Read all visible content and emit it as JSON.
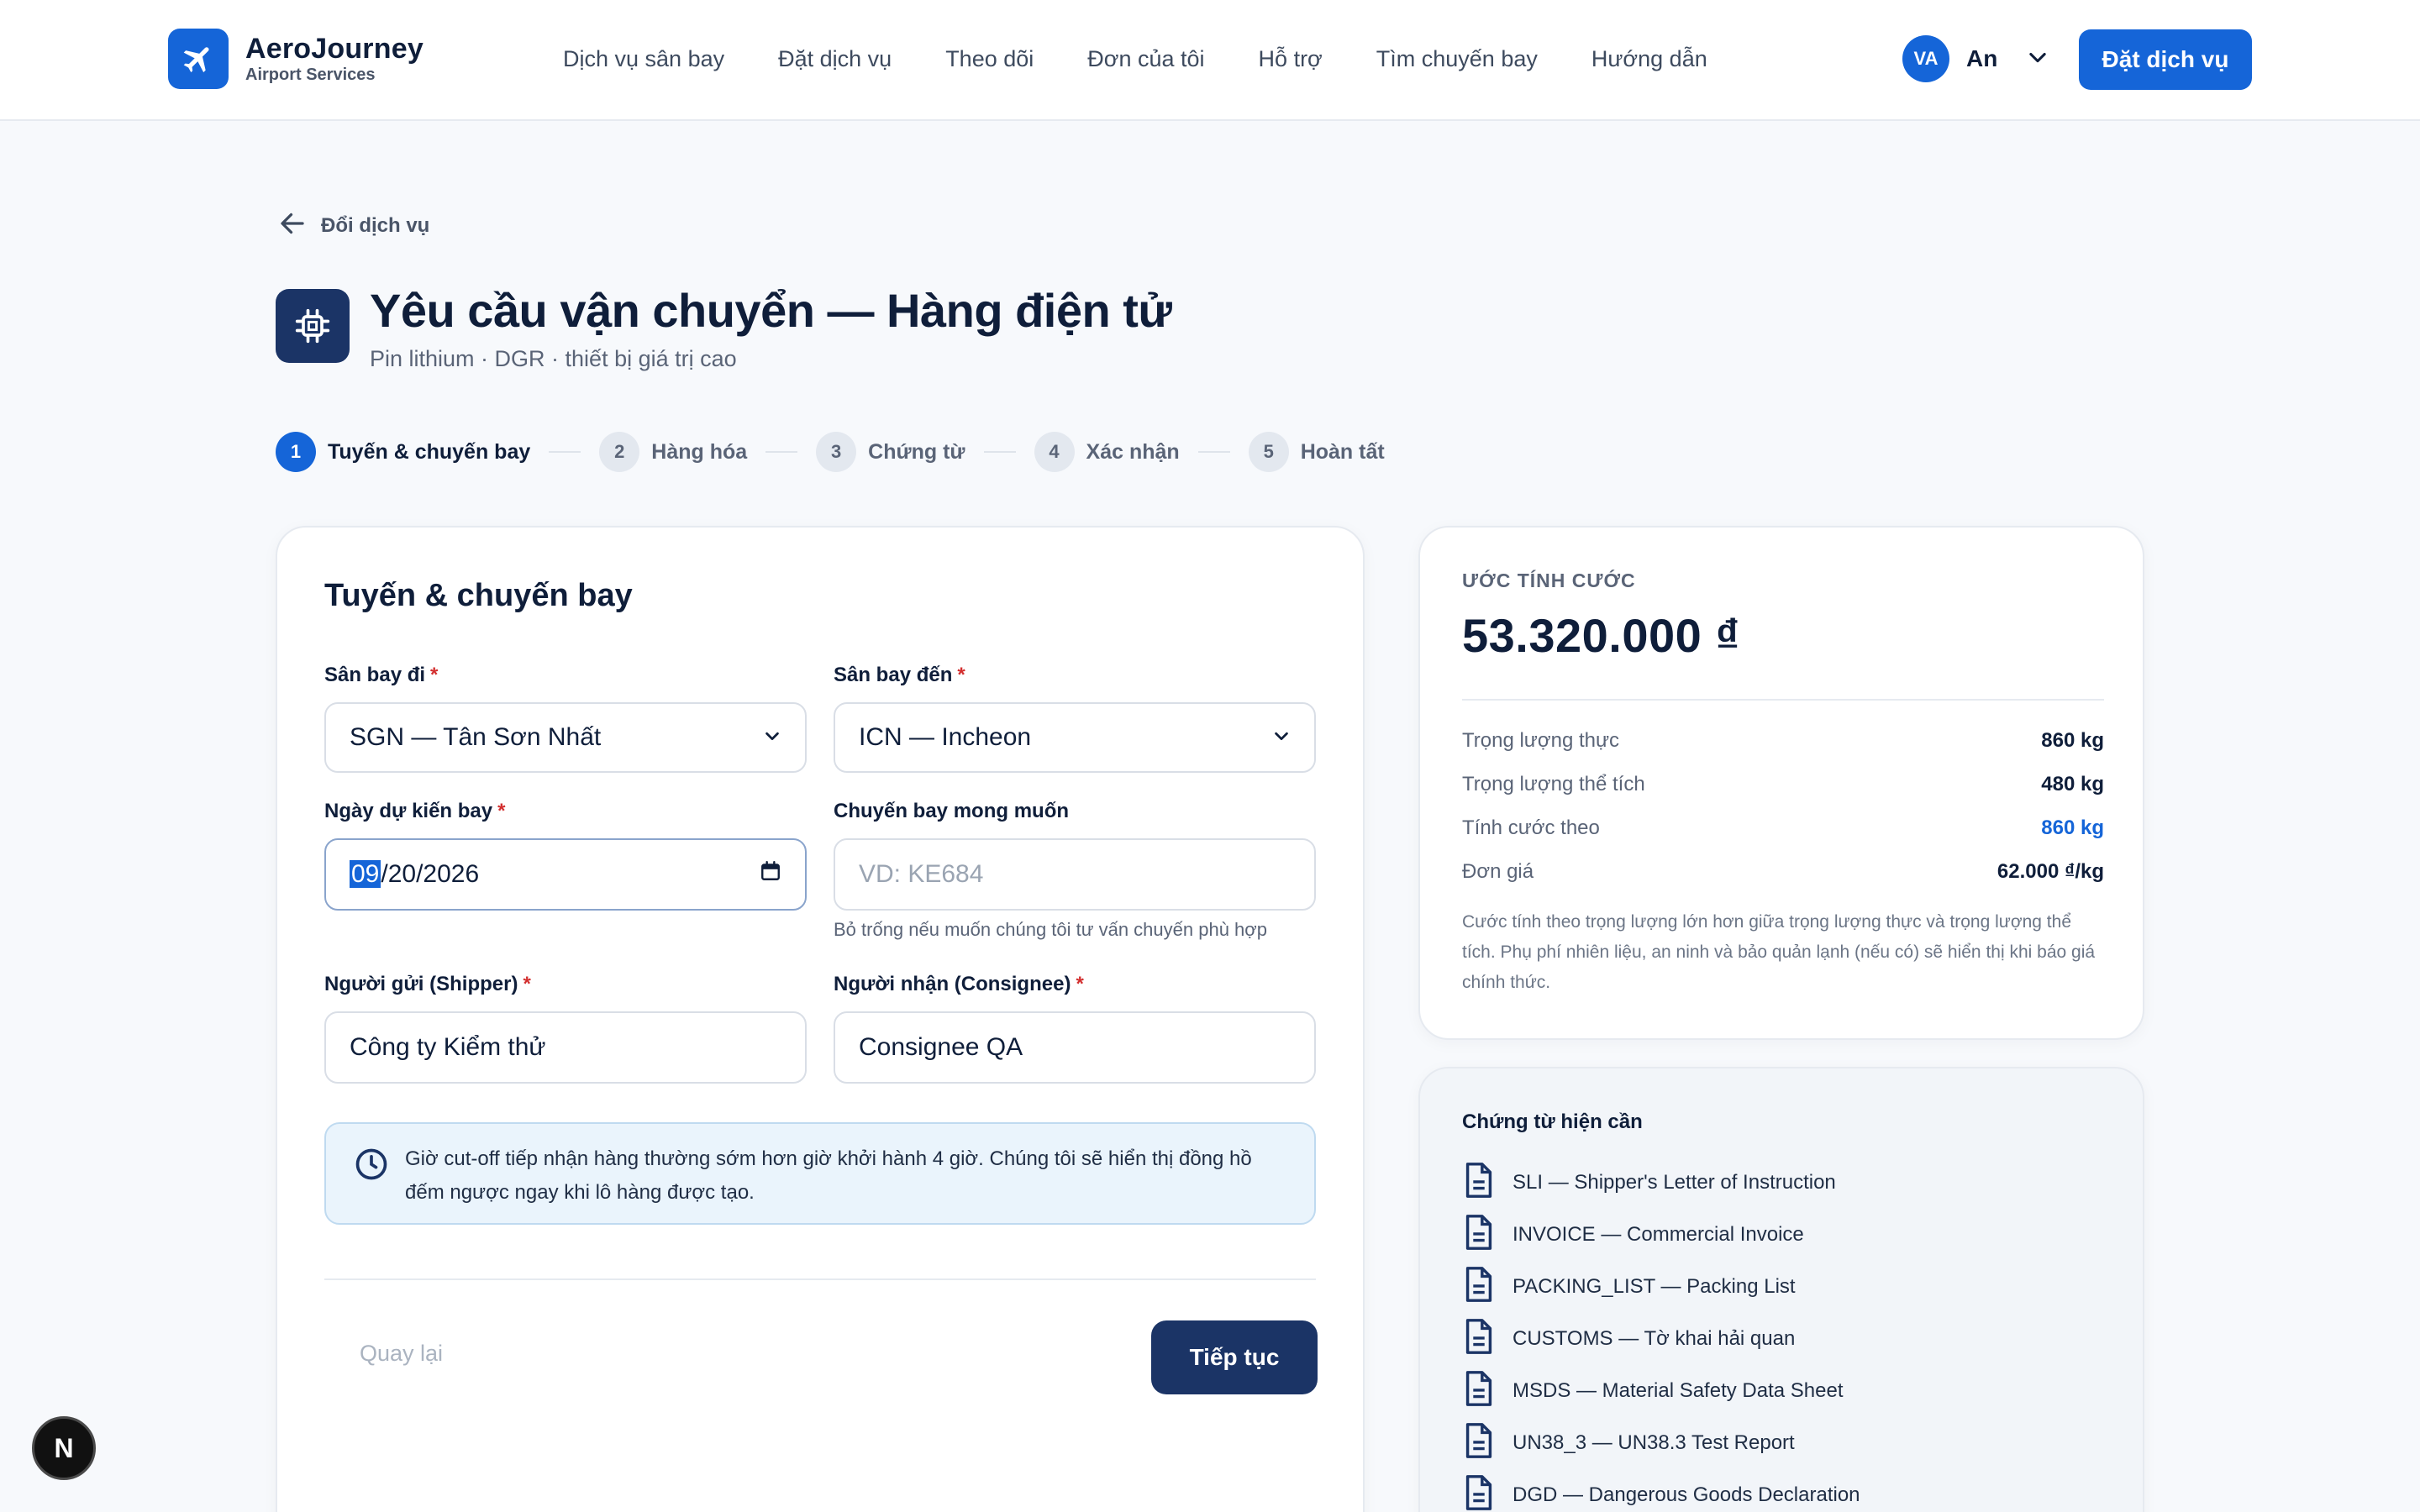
{
  "header": {
    "brand_name": "AeroJourney",
    "brand_sub": "Airport Services",
    "nav": [
      "Dịch vụ sân bay",
      "Đặt dịch vụ",
      "Theo dõi",
      "Đơn của tôi",
      "Hỗ trợ",
      "Tìm chuyến bay",
      "Hướng dẫn"
    ],
    "avatar_initials": "VA",
    "user_name": "An",
    "cta_label": "Đặt dịch vụ"
  },
  "page": {
    "back_label": "Đổi dịch vụ",
    "title": "Yêu cầu vận chuyển — Hàng điện tử",
    "subtitle": "Pin lithium · DGR · thiết bị giá trị cao"
  },
  "steps": [
    {
      "num": "1",
      "label": "Tuyến & chuyến bay"
    },
    {
      "num": "2",
      "label": "Hàng hóa"
    },
    {
      "num": "3",
      "label": "Chứng từ"
    },
    {
      "num": "4",
      "label": "Xác nhận"
    },
    {
      "num": "5",
      "label": "Hoàn tất"
    }
  ],
  "form": {
    "title": "Tuyến & chuyến bay",
    "origin_label": "Sân bay đi",
    "origin_value": "SGN — Tân Sơn Nhất",
    "dest_label": "Sân bay đến",
    "dest_value": "ICN — Incheon",
    "date_label": "Ngày dự kiến bay",
    "date_month": "09",
    "date_rest": "/20/2026",
    "flight_label": "Chuyến bay mong muốn",
    "flight_placeholder": "VD: KE684",
    "flight_helper": "Bỏ trống nếu muốn chúng tôi tư vấn chuyến phù hợp",
    "shipper_label": "Người gửi (Shipper)",
    "shipper_value": "Công ty Kiểm thử",
    "consignee_label": "Người nhận (Consignee)",
    "consignee_value": "Consignee QA",
    "required_mark": "*",
    "notice": "Giờ cut-off tiếp nhận hàng thường sớm hơn giờ khởi hành 4 giờ. Chúng tôi sẽ hiển thị đồng hồ đếm ngược ngay khi lô hàng được tạo.",
    "back_button": "Quay lại",
    "next_button": "Tiếp tục"
  },
  "estimate": {
    "kicker": "ƯỚC TÍNH CƯỚC",
    "total": "53.320.000 ₫",
    "rows": [
      {
        "label": "Trọng lượng thực",
        "value": "860 kg"
      },
      {
        "label": "Trọng lượng thể tích",
        "value": "480 kg"
      },
      {
        "label": "Tính cước theo",
        "value": "860 kg"
      },
      {
        "label": "Đơn giá",
        "value": "62.000 ₫/kg"
      }
    ],
    "note": "Cước tính theo trọng lượng lớn hơn giữa trọng lượng thực và trọng lượng thể tích. Phụ phí nhiên liệu, an ninh và bảo quản lạnh (nếu có) sẽ hiển thị khi báo giá chính thức."
  },
  "documents": {
    "title": "Chứng từ hiện cần",
    "items": [
      "SLI — Shipper's Letter of Instruction",
      "INVOICE — Commercial Invoice",
      "PACKING_LIST — Packing List",
      "CUSTOMS — Tờ khai hải quan",
      "MSDS — Material Safety Data Sheet",
      "UN38_3 — UN38.3 Test Report",
      "DGD — Dangerous Goods Declaration"
    ]
  },
  "badge": {
    "letter": "N"
  },
  "colors": {
    "brand": "#1565d8",
    "navy": "#1b3466",
    "required": "#d32f2f",
    "notice_bg": "#eaf4fc"
  },
  "icons": {
    "brand": "airplane-icon",
    "back": "arrow-left-icon",
    "title": "chip-icon",
    "user_menu": "chevron-down-icon",
    "select": "chevron-down-icon",
    "date": "calendar-icon",
    "notice": "clock-icon",
    "document": "document-icon"
  }
}
